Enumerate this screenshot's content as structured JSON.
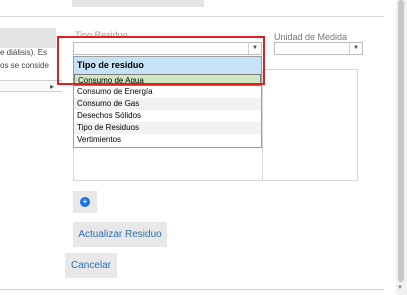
{
  "left_panel": {
    "text_line1": "e diálisis). Es",
    "text_line2": "os se conside",
    "row_arrow": "▸"
  },
  "form": {
    "tipo_label": "Tipo Residuo",
    "unidad_label": "Unidad de Medida",
    "select_arrow": "▼",
    "dropdown": {
      "header": "Tipo de residuo",
      "options": [
        "Consumo de Agua",
        "Consumo de Energía",
        "Consumo de Gas",
        "Desechos Sólidos",
        "Tipo de Residuos",
        "Vertimientos"
      ],
      "highlighted_index": 0
    }
  },
  "buttons": {
    "add_symbol": "+",
    "actualizar": "Actualizar Residuo",
    "cancelar": "Cancelar"
  },
  "colors": {
    "highlight_box": "#e11e24",
    "header_bg": "#c6e2f6",
    "option_hover": "#cfe8c0",
    "link_blue": "#2c6fb7",
    "add_blue": "#1a73e8"
  },
  "icons": {
    "add": "plus-circle-icon",
    "dropdown": "caret-down-icon",
    "expand": "caret-right-icon"
  }
}
